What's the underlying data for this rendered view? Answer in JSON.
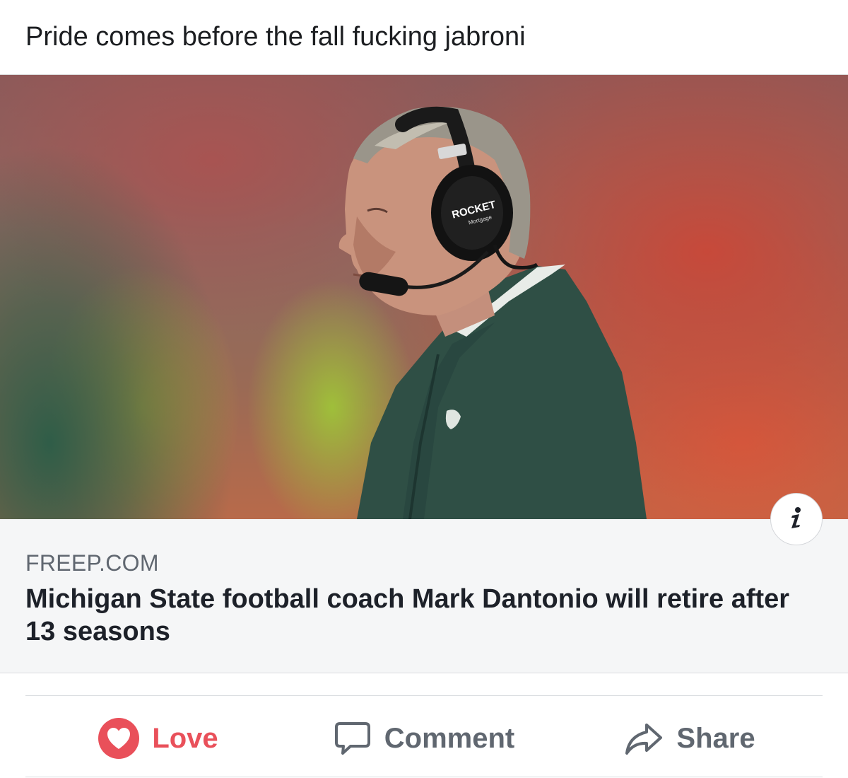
{
  "post": {
    "text": "Pride comes before the fall fucking jabroni"
  },
  "link": {
    "domain": "FREEP.COM",
    "headline": "Michigan State football coach Mark Dantonio will retire after 13 seasons",
    "image": {
      "headset_brand": "ROCKET",
      "headset_sub": "Mortgage"
    },
    "info_icon": "info-icon"
  },
  "actions": {
    "love_label": "Love",
    "comment_label": "Comment",
    "share_label": "Share",
    "love_color": "#e9505a",
    "icons": [
      "heart-icon",
      "comment-icon",
      "share-icon"
    ]
  }
}
